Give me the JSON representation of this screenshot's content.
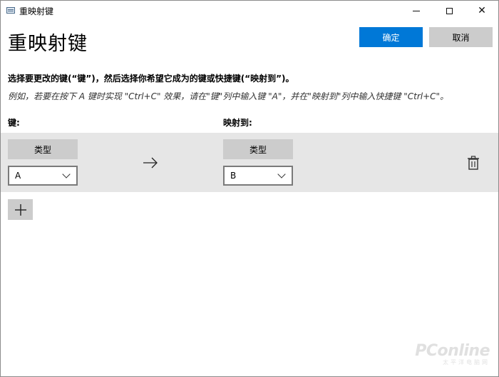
{
  "window": {
    "title": "重映射键",
    "min_icon": "minimize-icon",
    "max_icon": "maximize-icon",
    "close_label": "✕"
  },
  "header": {
    "title": "重映射键",
    "ok_label": "确定",
    "cancel_label": "取消",
    "accent_color": "#0078d7"
  },
  "instructions": {
    "main": "选择要更改的键(“键”)，然后选择你希望它成为的键或快捷键(“映射到”)。",
    "example": "例如，若要在按下 A 键时实现 \"Ctrl+C\" 效果，请在\"键\"列中输入键 \"A\"，并在\"映射到\"列中输入快捷键 \"Ctrl+C\"。"
  },
  "columns": {
    "key": "键:",
    "map_to": "映射到:"
  },
  "mappings": [
    {
      "key_type_label": "类型",
      "key_value": "A",
      "map_type_label": "类型",
      "map_value": "B"
    }
  ],
  "icons": {
    "arrow": "arrow-right-icon",
    "delete": "trash-icon",
    "add": "plus-icon"
  },
  "watermark": {
    "main": "PConline",
    "sub": "太平洋电脑网"
  }
}
